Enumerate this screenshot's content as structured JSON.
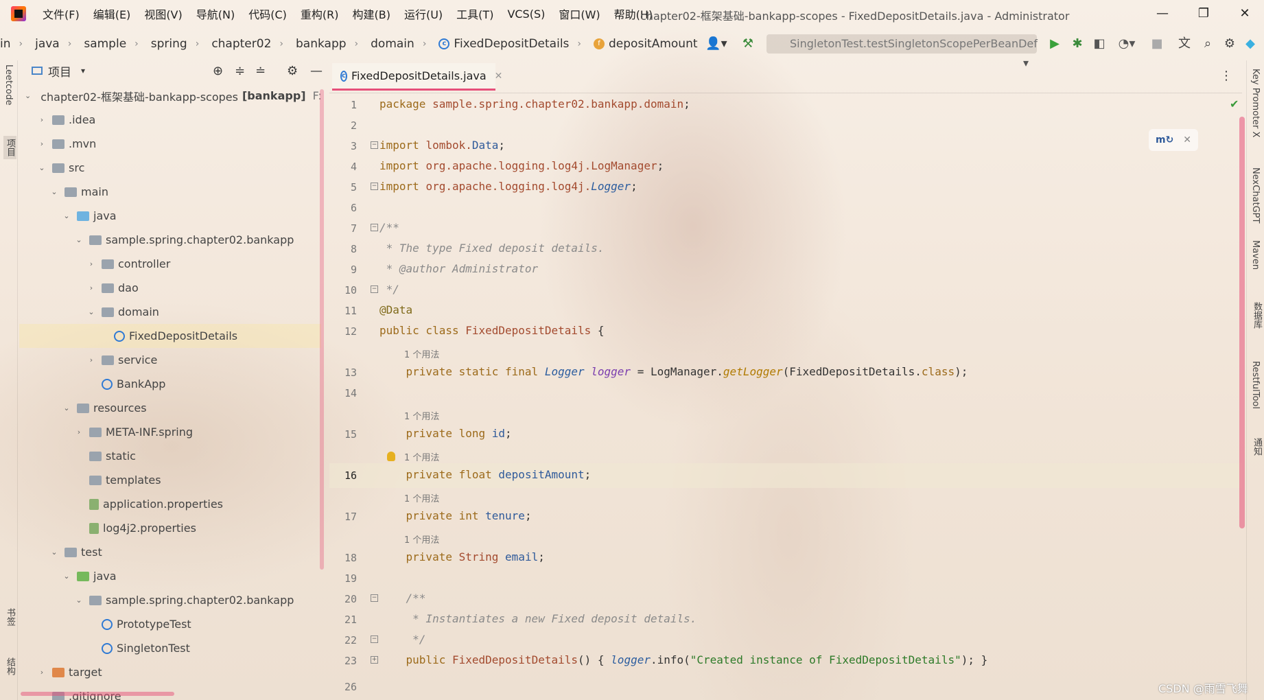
{
  "menubar": {
    "items": [
      "文件(F)",
      "编辑(E)",
      "视图(V)",
      "导航(N)",
      "代码(C)",
      "重构(R)",
      "构建(B)",
      "运行(U)",
      "工具(T)",
      "VCS(S)",
      "窗口(W)",
      "帮助(H)"
    ],
    "title": "chapter02-框架基础-bankapp-scopes - FixedDepositDetails.java - Administrator"
  },
  "navbar": {
    "crumbs": [
      "in",
      "java",
      "sample",
      "spring",
      "chapter02",
      "bankapp",
      "domain",
      "FixedDepositDetails",
      "depositAmount"
    ],
    "run_config": "SingletonTest.testSingletonScopePerBeanDef"
  },
  "leftstrip": {
    "top_label": "Leetcode",
    "project_label": "项目",
    "bookmarks_label": "书签",
    "structure_label": "结构"
  },
  "rightstrip": {
    "labels": [
      "Key Promoter X",
      "NexChatGPT",
      "Maven",
      "数据库",
      "RestfulTool",
      "通知"
    ]
  },
  "project": {
    "header": "项目",
    "root": "chapter02-框架基础-bankapp-scopes",
    "root_module": "[bankapp]",
    "root_path": "F:\\Jav",
    "tree": [
      {
        "label": ".idea",
        "indent": 1,
        "arrow": "›",
        "icon": "folder"
      },
      {
        "label": ".mvn",
        "indent": 1,
        "arrow": "›",
        "icon": "folder"
      },
      {
        "label": "src",
        "indent": 1,
        "arrow": "⌄",
        "icon": "folder"
      },
      {
        "label": "main",
        "indent": 2,
        "arrow": "⌄",
        "icon": "folder"
      },
      {
        "label": "java",
        "indent": 3,
        "arrow": "⌄",
        "icon": "folder-blue"
      },
      {
        "label": "sample.spring.chapter02.bankapp",
        "indent": 4,
        "arrow": "⌄",
        "icon": "package"
      },
      {
        "label": "controller",
        "indent": 5,
        "arrow": "›",
        "icon": "package"
      },
      {
        "label": "dao",
        "indent": 5,
        "arrow": "›",
        "icon": "package"
      },
      {
        "label": "domain",
        "indent": 5,
        "arrow": "⌄",
        "icon": "package"
      },
      {
        "label": "FixedDepositDetails",
        "indent": 6,
        "arrow": "",
        "icon": "class",
        "selected": true
      },
      {
        "label": "service",
        "indent": 5,
        "arrow": "›",
        "icon": "package"
      },
      {
        "label": "BankApp",
        "indent": 5,
        "arrow": "",
        "icon": "class"
      },
      {
        "label": "resources",
        "indent": 3,
        "arrow": "⌄",
        "icon": "folder-res"
      },
      {
        "label": "META-INF.spring",
        "indent": 4,
        "arrow": "›",
        "icon": "folder"
      },
      {
        "label": "static",
        "indent": 4,
        "arrow": "",
        "icon": "folder"
      },
      {
        "label": "templates",
        "indent": 4,
        "arrow": "",
        "icon": "folder"
      },
      {
        "label": "application.properties",
        "indent": 4,
        "arrow": "",
        "icon": "props"
      },
      {
        "label": "log4j2.properties",
        "indent": 4,
        "arrow": "",
        "icon": "props"
      },
      {
        "label": "test",
        "indent": 2,
        "arrow": "⌄",
        "icon": "folder"
      },
      {
        "label": "java",
        "indent": 3,
        "arrow": "⌄",
        "icon": "folder-green"
      },
      {
        "label": "sample.spring.chapter02.bankapp",
        "indent": 4,
        "arrow": "⌄",
        "icon": "package"
      },
      {
        "label": "PrototypeTest",
        "indent": 5,
        "arrow": "",
        "icon": "class"
      },
      {
        "label": "SingletonTest",
        "indent": 5,
        "arrow": "",
        "icon": "class"
      },
      {
        "label": "target",
        "indent": 1,
        "arrow": "›",
        "icon": "folder-orange"
      },
      {
        "label": ".gitignore",
        "indent": 1,
        "arrow": "",
        "icon": "file"
      }
    ]
  },
  "editor": {
    "tab": "FixedDepositDetails.java",
    "usage_hint": "1 个用法",
    "line_numbers": [
      "1",
      "2",
      "3",
      "4",
      "5",
      "6",
      "7",
      "8",
      "9",
      "10",
      "11",
      "12",
      "13",
      "14",
      "15",
      "16",
      "17",
      "18",
      "19",
      "20",
      "21",
      "22",
      "23",
      "26"
    ]
  },
  "watermark": "CSDN @雨雪飞舞"
}
